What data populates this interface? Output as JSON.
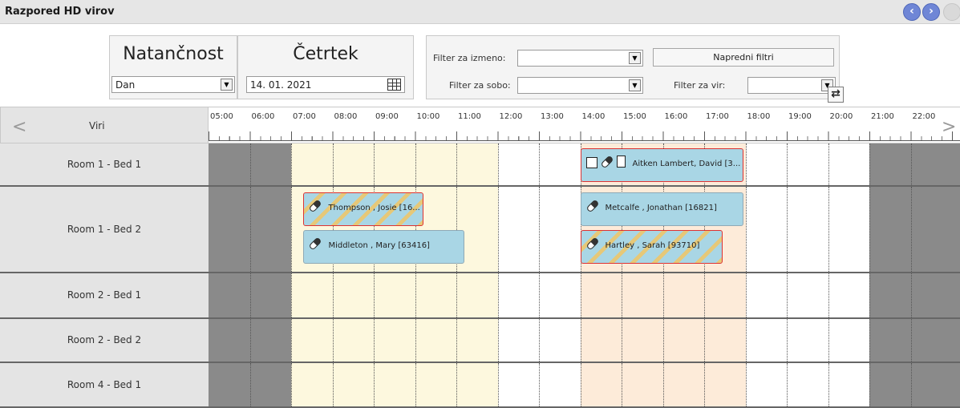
{
  "window": {
    "title": "Razpored HD virov"
  },
  "nav": {
    "prev": "‹",
    "next": "›",
    "extra": ""
  },
  "precision": {
    "heading": "Natančnost",
    "value": "Dan"
  },
  "day": {
    "heading": "Četrtek",
    "date": "14. 01. 2021"
  },
  "filters": {
    "shift_label": "Filter za izmeno:",
    "shift_value": "",
    "room_label": "Filter za sobo:",
    "room_value": "",
    "resource_label": "Filter za vir:",
    "resource_value": "",
    "advanced_button": "Napredni filtri",
    "refresh_icon": "refresh-icon"
  },
  "schedule": {
    "resources_header": "Viri",
    "times": [
      "05:00",
      "06:00",
      "07:00",
      "08:00",
      "09:00",
      "10:00",
      "11:00",
      "12:00",
      "13:00",
      "14:00",
      "15:00",
      "16:00",
      "17:00",
      "18:00",
      "19:00",
      "20:00",
      "21:00",
      "22:00"
    ],
    "rows": [
      {
        "label": "Room 1 - Bed 1"
      },
      {
        "label": "Room 1 - Bed 2"
      },
      {
        "label": "Room 2 - Bed 1"
      },
      {
        "label": "Room 2 - Bed 2"
      },
      {
        "label": "Room 4 - Bed 1"
      }
    ],
    "events": [
      {
        "text": "Aitken Lambert, David [3...",
        "status": "alert-red-border",
        "icons": [
          "printer-icon",
          "pill-icon",
          "document-icon"
        ]
      },
      {
        "text": "Thompson , Josie  [16...",
        "status": "alert-striped",
        "icons": [
          "pill-icon"
        ]
      },
      {
        "text": "Metcalfe , Jonathan  [16821]",
        "status": "normal",
        "icons": [
          "pill-icon"
        ]
      },
      {
        "text": "Middleton , Mary [63416]",
        "status": "normal",
        "icons": [
          "pill-icon"
        ]
      },
      {
        "text": "Hartley , Sarah [93710]",
        "status": "alert-striped",
        "icons": [
          "pill-icon"
        ]
      }
    ]
  },
  "colors": {
    "non_working": "#8a8a8a",
    "morning_shift": "#fdf8de",
    "afternoon_shift": "#fdebd9",
    "event": "#a9d6e5",
    "alert_border": "#dd3333",
    "nav_button": "#6f86d6"
  }
}
